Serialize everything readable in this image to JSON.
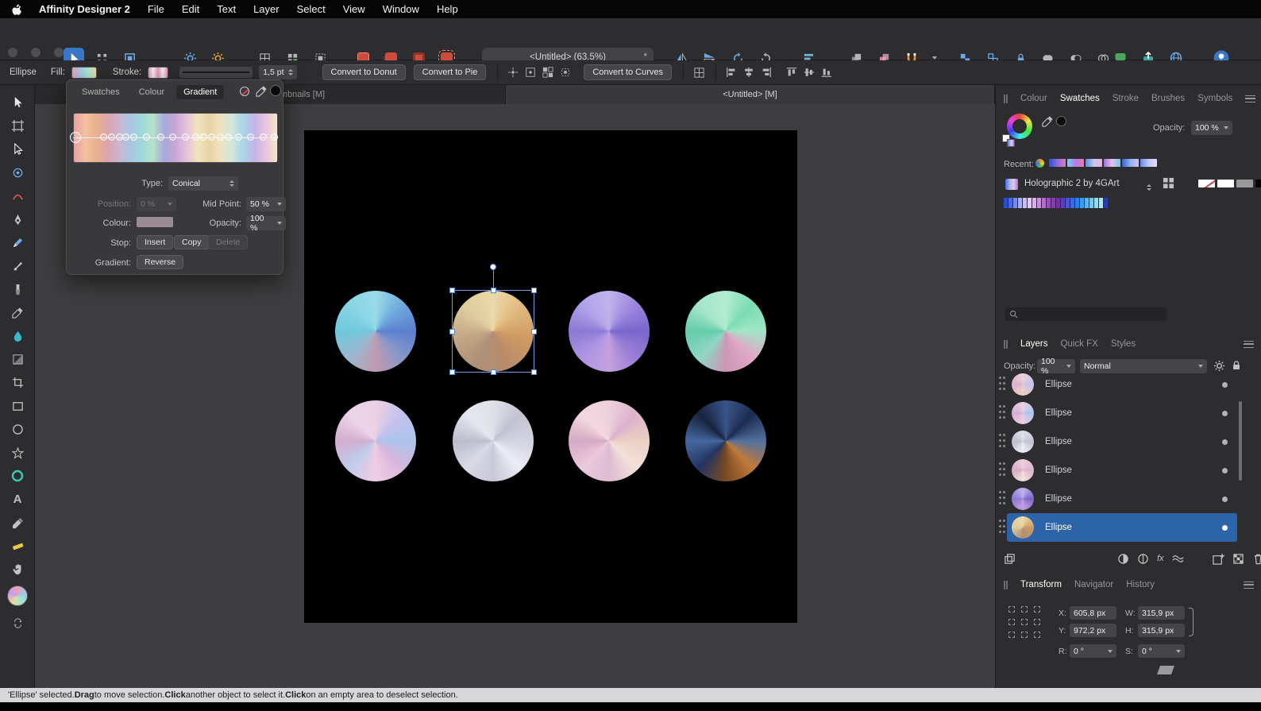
{
  "menu_bar": {
    "app_name": "Affinity Designer 2",
    "items": [
      "File",
      "Edit",
      "Text",
      "Layer",
      "Select",
      "View",
      "Window",
      "Help"
    ]
  },
  "toolbar": {
    "document_title": "<Untitled> (63.5%)",
    "modified_indicator": "*"
  },
  "context_toolbar": {
    "tool_label": "Ellipse",
    "fill_label": "Fill:",
    "stroke_label": "Stroke:",
    "stroke_width": "1,5 pt",
    "convert_donut": "Convert to Donut",
    "convert_pie": "Convert to Pie",
    "convert_curves": "Convert to Curves"
  },
  "gradient_panel": {
    "tabs": [
      "Swatches",
      "Colour",
      "Gradient"
    ],
    "active_tab": "Gradient",
    "type_label": "Type:",
    "type_value": "Conical",
    "position_label": "Position:",
    "position_value": "0 %",
    "midpoint_label": "Mid Point:",
    "midpoint_value": "50 %",
    "colour_label": "Colour:",
    "colour_value": "#9b8b95",
    "opacity_label": "Opacity:",
    "opacity_value": "100 %",
    "stop_label": "Stop:",
    "insert_button": "Insert",
    "copy_button": "Copy",
    "delete_button": "Delete",
    "gradient_label": "Gradient:",
    "reverse_button": "Reverse",
    "strip_colors": [
      "#ee9fa0",
      "#f2c0a0",
      "#eab190",
      "#dba4ad",
      "#cbb6cf",
      "#a9c6e5",
      "#9ed7dd",
      "#b6e2c8",
      "#a8a8dc",
      "#c8a7d7",
      "#e6c2dc",
      "#f1e5bd",
      "#e8d2a4",
      "#f0e2c0",
      "#cfe8d8",
      "#a9d4ea",
      "#c4b4e4",
      "#e8c4e0",
      "#f4e8c8"
    ],
    "stop_positions": [
      1,
      15,
      19,
      23,
      26,
      30,
      36,
      43,
      49,
      55,
      60,
      64,
      68,
      72,
      76,
      81,
      87,
      93,
      98.5
    ]
  },
  "document_tabs": {
    "tab1": "ity Thumbnails [M]",
    "tab2": "<Untitled> [M]"
  },
  "right_panel": {
    "studio_tabs": [
      "Colour",
      "Swatches",
      "Stroke",
      "Brushes",
      "Symbols"
    ],
    "active_studio_tab": "Swatches",
    "opacity_label": "Opacity:",
    "opacity_value": "100 %",
    "recent_label": "Recent:",
    "recent_dot_colors": [
      "#e8882a",
      "#e8d82a",
      "#4ab84a",
      "#2a7de8",
      "#e8882a"
    ],
    "recent_chips": [
      [
        "#2a50d8",
        "#8a6ae0",
        "#e87ab8"
      ],
      [
        "#7ad0f0",
        "#b07be9",
        "#e97bb0"
      ],
      [
        "#4a90e8",
        "#c8c8f0",
        "#e8b0d8"
      ],
      [
        "#9a70e0",
        "#e8c0e8",
        "#70c8e8"
      ],
      [
        "#3a60d8",
        "#90b0f0",
        "#d8c0f0"
      ],
      [
        "#6a88e8",
        "#b8c8f8",
        "#e8d8f8"
      ]
    ],
    "palette_name": "Holographic 2 by 4GArt",
    "palette_chip_colors": [
      "#4a6ae0",
      "#a8b0f0",
      "#e0ccf8",
      "#b070c8"
    ],
    "palette_swatches": [
      "#2a4ed0",
      "#4a6ae0",
      "#7a8ae8",
      "#a8b0f0",
      "#c8c0f4",
      "#e0ccf8",
      "#d8b0e8",
      "#c890d8",
      "#b070c8",
      "#9850b8",
      "#8040a8",
      "#6a3598",
      "#5a3fb8",
      "#4a55d0",
      "#3a6ae0",
      "#2a80e8",
      "#3a9af0",
      "#5ab4f4",
      "#7ac8f0",
      "#9ad8ec",
      "#b4e4ec",
      "#2a3ab0"
    ],
    "grayscale_swatches": [
      "none",
      "#ffffff",
      "#9a9a9c",
      "#000000"
    ],
    "hue_wheel_colors": [
      "#e84040",
      "#e8e840",
      "#40e840",
      "#40e8e8",
      "#4040e8",
      "#e840e8",
      "#e84040"
    ],
    "layers_tabs": [
      "Layers",
      "Quick FX",
      "Styles"
    ],
    "active_layers_tab": "Layers",
    "layers_opacity_label": "Opacity:",
    "layers_opacity_value": "100 %",
    "blend_mode": "Normal",
    "fx_icon_label": "fx",
    "layers": [
      {
        "name": "Ellipse",
        "thumb_colors": [
          "#ecd0dc",
          "#c4c2ec",
          "#ecd0c4",
          "#dcb2cc",
          "#ecd0dc"
        ]
      },
      {
        "name": "Ellipse",
        "thumb_colors": [
          "#ecd0e4",
          "#aac4ec",
          "#f0cce4",
          "#d2aed0",
          "#ecd0e4"
        ]
      },
      {
        "name": "Ellipse",
        "thumb_colors": [
          "#e0e0ea",
          "#c2c2d2",
          "#ecedf4",
          "#bcbccc",
          "#e0e0ea"
        ]
      },
      {
        "name": "Ellipse",
        "thumb_colors": [
          "#ecd0dc",
          "#dcb2cc",
          "#f4e0da",
          "#d4aac2",
          "#ecd0dc"
        ]
      },
      {
        "name": "Ellipse",
        "thumb_colors": [
          "#c0b2ec",
          "#7a66cc",
          "#c4a0e0",
          "#8a7ad4",
          "#c0b2ec"
        ]
      },
      {
        "name": "Ellipse",
        "thumb_colors": [
          "#ead9a8",
          "#cf9a62",
          "#ad9078",
          "#decb9e",
          "#ead9a8"
        ]
      }
    ],
    "transform_tabs": [
      "Transform",
      "Navigator",
      "History"
    ],
    "active_transform_tab": "Transform",
    "transform": {
      "x_label": "X:",
      "x_value": "605,8 px",
      "y_label": "Y:",
      "y_value": "972,2 px",
      "w_label": "W:",
      "w_value": "315,9 px",
      "h_label": "H:",
      "h_value": "315,9 px",
      "r_label": "R:",
      "r_value": "0 °",
      "s_label": "S:",
      "s_value": "0 °"
    }
  },
  "left_tools": {
    "text_tool_label": "A",
    "fill_indicator_colors": [
      "#e8a0b8",
      "#a0c8e8",
      "#a0e8d0",
      "#e8d8a0",
      "#c8a0e8",
      "#e8a0b8"
    ]
  },
  "canvas": {
    "zoom": "63.5%",
    "circles": [
      {
        "colors": [
          "#9adbe8",
          "#6fa8dc",
          "#5b7fd0",
          "#8898c8",
          "#c09ab0",
          "#9ab8d0",
          "#70c8dc",
          "#86d4e4",
          "#9adbe8"
        ]
      },
      {
        "colors": [
          "#ead9a8",
          "#e0b77e",
          "#cf9a62",
          "#b98c6a",
          "#ad9078",
          "#c3a584",
          "#decb9e",
          "#ead9a8"
        ]
      },
      {
        "colors": [
          "#c0b2ec",
          "#9a86dc",
          "#7a66cc",
          "#9a7ed4",
          "#c4a0e0",
          "#ae96e4",
          "#8a7ad4",
          "#b0a2e8",
          "#c0b2ec"
        ]
      },
      {
        "colors": [
          "#b2ecd0",
          "#7adcb2",
          "#a2e4c8",
          "#e0a8c6",
          "#cc96b4",
          "#8ed8c4",
          "#66ccaa",
          "#a6e6cc",
          "#b2ecd0"
        ]
      },
      {
        "colors": [
          "#ecd0e4",
          "#c4c2ec",
          "#aac4ec",
          "#d8b6dc",
          "#f0cce4",
          "#c0ccec",
          "#d2aed0",
          "#ecd4e8",
          "#ecd0e4"
        ]
      },
      {
        "colors": [
          "#e0e0ea",
          "#c2c2d2",
          "#d2d2e0",
          "#ecedf4",
          "#c8c8d8",
          "#dadae6",
          "#bcbccc",
          "#e6e6ee",
          "#e0e0ea"
        ]
      },
      {
        "colors": [
          "#ecd0dc",
          "#dcb2cc",
          "#ecd0c4",
          "#f4e0da",
          "#dcbcd2",
          "#ecc8dc",
          "#d4aac2",
          "#f4d8e0",
          "#ecd0dc"
        ]
      },
      {
        "colors": [
          "#3a5488",
          "#1c2c50",
          "#52709f",
          "#c07a3a",
          "#7a4a22",
          "#243462",
          "#4668a0",
          "#16243e",
          "#3a5488"
        ]
      }
    ]
  },
  "status_bar": {
    "segments": [
      "'Ellipse' selected. ",
      "Drag",
      " to move selection. ",
      "Click",
      " another object to select it. ",
      "Click",
      " on an empty area to deselect selection."
    ]
  },
  "colors": {
    "accent_blue": "#3a76c8",
    "selection_blue": "#2d63a8",
    "context_fill_chip": [
      "#e8a0b0",
      "#a8c8e8",
      "#a8e8d0",
      "#e8d8a8"
    ],
    "context_stroke_chip": [
      "#e890b8",
      "#f0f0f0",
      "#e890b8",
      "#f0f0f0",
      "#e890b8"
    ]
  }
}
